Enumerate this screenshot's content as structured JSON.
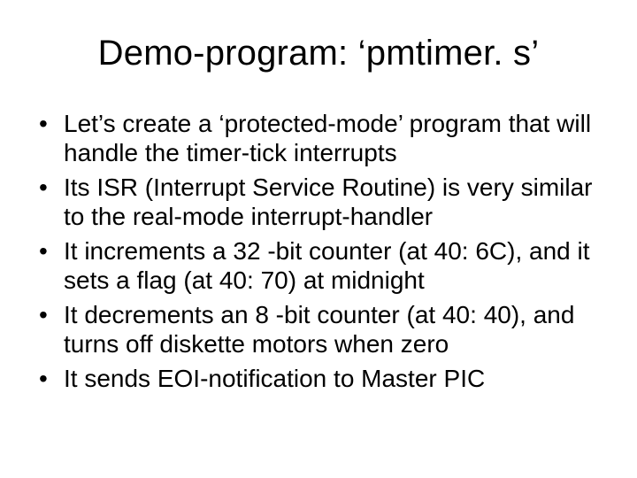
{
  "title": "Demo-program: ‘pmtimer. s’",
  "bullets": [
    "Let’s create a ‘protected-mode’ program that will handle the timer-tick interrupts",
    "Its ISR (Interrupt Service Routine) is very similar to the real-mode interrupt-handler",
    "It increments a 32 -bit counter (at 40: 6C), and it sets a flag (at 40: 70) at midnight",
    "It decrements an 8 -bit counter (at 40: 40), and turns off diskette motors when zero",
    "It sends EOI-notification to Master PIC"
  ]
}
